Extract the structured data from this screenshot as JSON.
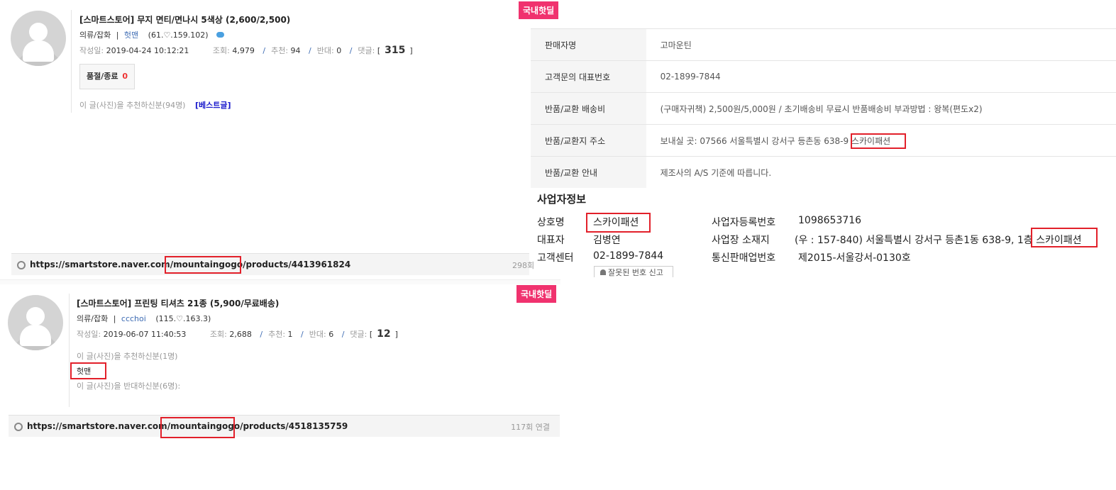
{
  "post1": {
    "badge": "국내핫딜",
    "title": "[스마트스토어] 무지 면티/면나시 5색상 (2,600/2,500)",
    "category": "의류/잡화",
    "author": "헛맨",
    "ip": "(61.♡.159.102)",
    "date_label": "작성일:",
    "date": "2019-04-24 10:12:21",
    "views_label": "조회:",
    "views": "4,979",
    "recommend_label": "추천:",
    "recommend": "94",
    "oppose_label": "반대:",
    "oppose": "0",
    "comments_label": "댓글:",
    "comments": "315",
    "soldout_label": "품절/종료",
    "soldout_count": "0",
    "recommenders_text": "이 글(사진)을 추천하신분(94명)",
    "best_label": "[베스트글]",
    "link_prefix": "https://smartstore.naver.com",
    "link_store": "/mountaingogo/",
    "link_suffix": "products/4413961824",
    "link_count": "298회"
  },
  "post2": {
    "badge": "국내핫딜",
    "title": "[스마트스토어] 프린팅 티셔츠 21종 (5,900/무료배송)",
    "category": "의류/잡화",
    "author": "ccchoi",
    "ip": "(115.♡.163.3)",
    "date_label": "작성일:",
    "date": "2019-06-07 11:40:53",
    "views_label": "조회:",
    "views": "2,688",
    "recommend_label": "추천:",
    "recommend": "1",
    "oppose_label": "반대:",
    "oppose": "6",
    "comments_label": "댓글:",
    "comments": "12",
    "recommenders_text": "이 글(사진)을 추천하신분(1명)",
    "recommender": "헛맨",
    "opposers_text": "이 글(사진)을 반대하신분(6명):",
    "link_prefix": "https://smartstore.naver.com",
    "link_store": "/mountaingogo/",
    "link_suffix": "products/4518135759",
    "link_count": "117회 연결"
  },
  "seller_table": [
    {
      "key": "판매자명",
      "value": "고마운틴"
    },
    {
      "key": "고객문의 대표번호",
      "value": "02-1899-7844"
    },
    {
      "key": "반품/교환 배송비",
      "value": "(구매자귀책) 2,500원/5,000원 / 초기배송비 무료시 반품배송비 부과방법 : 왕복(편도x2)"
    },
    {
      "key": "반품/교환지 주소",
      "value": "보내실 곳: 07566 서울특별시 강서구 등촌동 638-9 ",
      "highlight": "스카이패션"
    },
    {
      "key": "반품/교환 안내",
      "value": "제조사의 A/S 기준에 따릅니다."
    }
  ],
  "business": {
    "heading": "사업자정보",
    "company_label": "상호명",
    "company": "스카이패션",
    "ceo_label": "대표자",
    "ceo": "김병연",
    "cs_label": "고객센터",
    "cs": "02-1899-7844",
    "report_button": "잘못된 번호 신고",
    "regno_label": "사업자등록번호",
    "regno": "1098653716",
    "address_label": "사업장 소재지",
    "address": "(우 : 157-840) 서울특별시 강서구 등촌1동 638-9, 1층 ",
    "address_highlight": "스카이패션",
    "mail_label": "통신판매업번호",
    "mail": "제2015-서울강서-0130호"
  },
  "colors": {
    "badge": "#f0326e",
    "highlight_box": "#e2202a",
    "link_blue": "#3d6bb3",
    "best_blue": "#1a1acc"
  }
}
